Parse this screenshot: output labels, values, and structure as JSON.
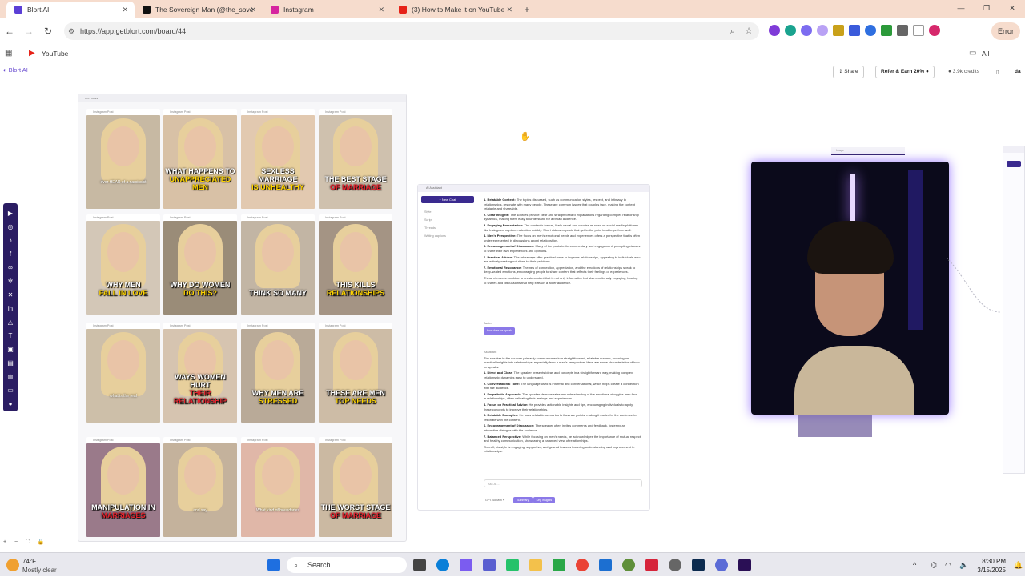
{
  "browser": {
    "tabs": [
      {
        "title": "Blort AI",
        "color": "#5b3fd6",
        "active": true
      },
      {
        "title": "The Sovereign Man (@the_sove",
        "color": "#111111",
        "active": false
      },
      {
        "title": "Instagram",
        "color": "#d6249f",
        "active": false
      },
      {
        "title": "(3) How to Make it on YouTube",
        "color": "#e62117",
        "active": false
      }
    ],
    "url": "https://app.getblort.com/board/44",
    "profile_button": "Error",
    "bookmarks": {
      "youtube": "YouTube",
      "all": "All Bookmarks"
    }
  },
  "app": {
    "logo": "Blort AI",
    "share": "Share",
    "refer": "Refer & Earn 20%",
    "credits": "3.9k credits",
    "user": "da"
  },
  "board": {
    "title": "reel rows",
    "post_label": "Instagram Post",
    "cards": [
      {
        "caption": "",
        "caption_b": "",
        "sub": "ever HEAR of a narcissist",
        "bg": "#c7b9a3"
      },
      {
        "caption": "What Happens to",
        "caption_b": "Unappreciated Men",
        "sub": "",
        "bg": "#d8c1a6"
      },
      {
        "caption": "Sexless Marriage",
        "caption_b": "is Unhealthy",
        "sub": "",
        "bg": "#e2c9b0"
      },
      {
        "caption": "The Best Stage",
        "caption_b": "of Marriage",
        "sub": "",
        "bg": "#cfc1ae"
      },
      {
        "caption": "Why Men",
        "caption_b": "Fall in Love",
        "sub": "",
        "bg": "#d3c7b7"
      },
      {
        "caption": "Why do Women",
        "caption_b": "Do This?",
        "sub": "",
        "bg": "#9a8c78"
      },
      {
        "caption": "think so many",
        "caption_b": "",
        "sub": "",
        "bg": "#c2b5a4"
      },
      {
        "caption": "This Kills",
        "caption_b": "Relationships",
        "sub": "",
        "bg": "#a49484"
      },
      {
        "caption": "",
        "caption_b": "",
        "sub": "what is the real",
        "bg": "#cdbfa9"
      },
      {
        "caption": "Ways Women Hurt",
        "caption_b": "Their Relationship",
        "sub": "",
        "bg": "#d6c4b0"
      },
      {
        "caption": "Why Men Are",
        "caption_b": "Stressed",
        "sub": "",
        "bg": "#b9aa98"
      },
      {
        "caption": "These Are Men",
        "caption_b": "Top Needs",
        "sub": "",
        "bg": "#cdbca6"
      },
      {
        "caption": "Manipulation in",
        "caption_b": "Marriages",
        "sub": "",
        "bg": "#9a7a8a"
      },
      {
        "caption": "",
        "caption_b": "",
        "sub": "and say",
        "bg": "#c4b29c"
      },
      {
        "caption": "",
        "caption_b": "",
        "sub": "What kind of boundaries",
        "bg": "#e0b7a8"
      },
      {
        "caption": "The Worst Stage",
        "caption_b": "of Marriage",
        "sub": "",
        "bg": "#cbb9a2"
      }
    ]
  },
  "chat": {
    "title": "AI Assistant",
    "new_chat": "+ New Chat",
    "side_items": [
      "Style",
      "Script",
      "Threads",
      "Writing captions"
    ],
    "answer1": [
      {
        "k": "Relatable Content:",
        "v": "The topics discussed, such as communication styles, respect, and intimacy in relationships, resonate with many people. These are common issues that couples face, making the content relatable and shareable."
      },
      {
        "k": "Clear Insights:",
        "v": "The sources provide clear and straightforward explanations regarding complex relationship dynamics, making them easy to understand for a broad audience."
      },
      {
        "k": "Engaging Presentation:",
        "v": "The content's format, likely visual and concise as seen on social media platforms like Instagram, captures attention quickly. Short videos or posts that get to the point tend to perform well."
      },
      {
        "k": "Men's Perspective:",
        "v": "The focus on men's emotional needs and experiences offers a perspective that is often underrepresented in discussions about relationships."
      },
      {
        "k": "Encouragement of Discussion:",
        "v": "Many of the posts invite commentary and engagement, prompting viewers to share their own experiences and opinions."
      },
      {
        "k": "Practical Advice:",
        "v": "The takeaways offer practical ways to improve relationships, appealing to individuals who are actively seeking solutions to their problems."
      },
      {
        "k": "Emotional Resonance:",
        "v": "Themes of connection, appreciation, and the emotions of relationships speak to deep-seated emotions, encouraging people to share content that reflects their feelings or experiences."
      }
    ],
    "answer1_close": "These elements combine to create content that is not only informative but also emotionally engaging, leading to shares and discussions that help it reach a wider audience.",
    "user_label": "Jaden",
    "user_pill": "how does he speak",
    "assistant_label": "Assistant",
    "answer2_intro": "The speaker in the sources primarily communicates in a straightforward, relatable manner, focusing on practical insights into relationships, especially from a man's perspective. Here are some characteristics of how he speaks:",
    "answer2": [
      {
        "k": "Direct and Clear:",
        "v": "The speaker presents ideas and concepts in a straightforward way, making complex relationship dynamics easy to understand."
      },
      {
        "k": "Conversational Tone:",
        "v": "The language used is informal and conversational, which helps create a connection with the audience."
      },
      {
        "k": "Empathetic Approach:",
        "v": "The speaker demonstrates an understanding of the emotional struggles men face in relationships, often validating their feelings and experiences."
      },
      {
        "k": "Focus on Practical Advice:",
        "v": "He provides actionable insights and tips, encouraging individuals to apply these concepts to improve their relationships."
      },
      {
        "k": "Relatable Examples:",
        "v": "He uses relatable scenarios to illustrate points, making it easier for the audience to resonate with the content."
      },
      {
        "k": "Encouragement of Discussion:",
        "v": "The speaker often invites comments and feedback, fostering an interactive dialogue with the audience."
      },
      {
        "k": "Balanced Perspective:",
        "v": "While focusing on men's needs, he acknowledges the importance of mutual respect and healthy communication, showcasing a balanced view of relationships."
      }
    ],
    "answer2_close": "Overall, his style is engaging, supportive, and geared towards fostering understanding and improvement in relationships.",
    "input_placeholder": "Ask AI...",
    "model": "GPT-4o Mini",
    "chips": [
      "Summary",
      "Key Insights"
    ]
  },
  "video_node": {
    "label": "Image"
  },
  "taskbar": {
    "weather_temp": "74°F",
    "weather_desc": "Mostly clear",
    "search": "Search",
    "time": "8:30 PM",
    "date": "3/15/2025"
  },
  "colors": {
    "accent": "#5b3fd6",
    "tab_strip": "#f6dccd",
    "toolbar_dark": "#2b1d63"
  }
}
